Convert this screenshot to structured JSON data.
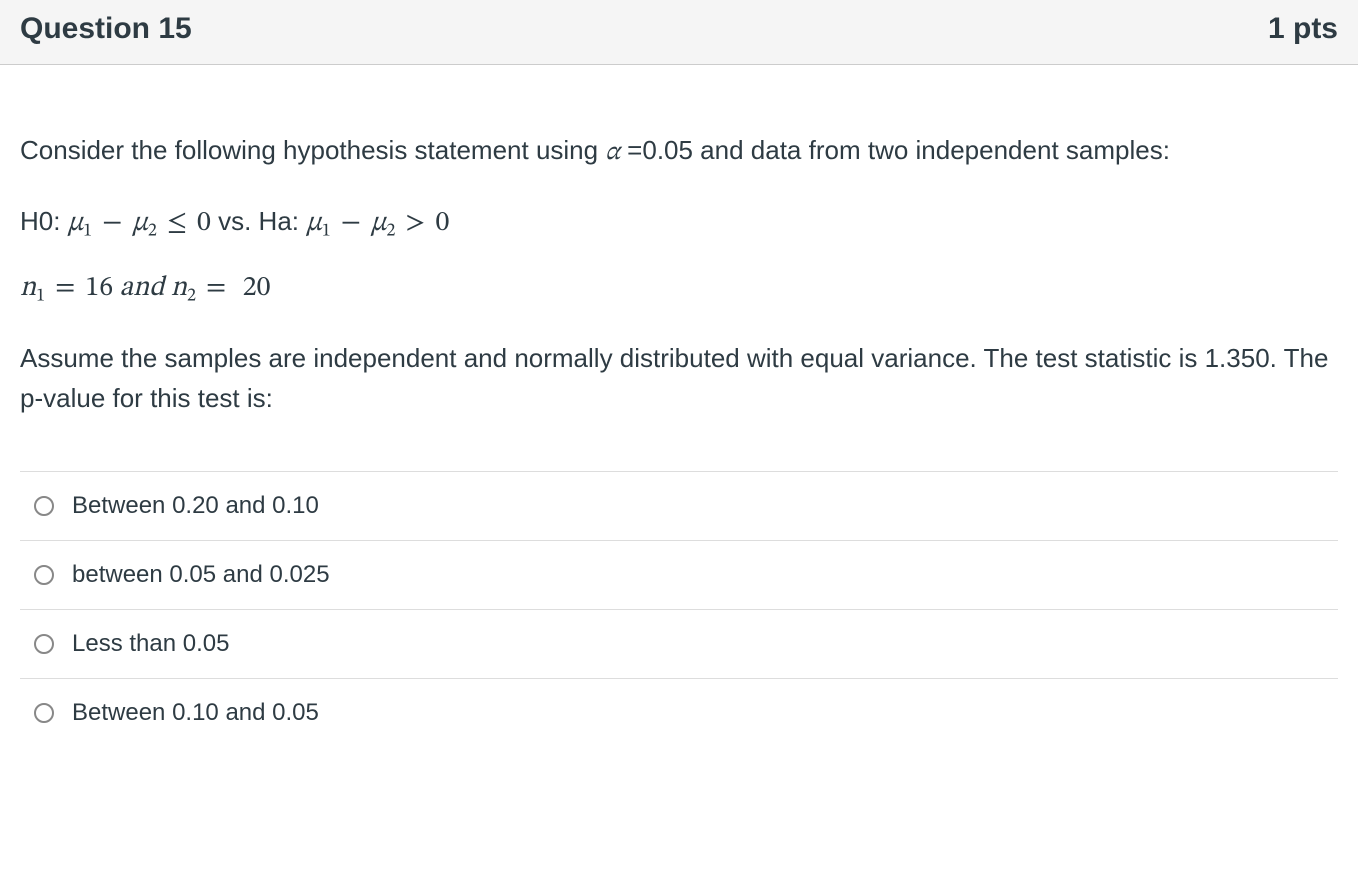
{
  "header": {
    "title": "Question 15",
    "points": "1 pts"
  },
  "prompt": {
    "intro_pre": "Consider the following hypothesis statement using ",
    "alpha_sym": "α",
    "alpha_eq": " =",
    "alpha_val": "0.05 and data from two independent samples:"
  },
  "hypothesis": {
    "h0_label": "H0:  ",
    "mu": "μ",
    "one": "1",
    "two": "2",
    "minus": "−",
    "le": "≤",
    "zero": "0",
    "vs_label": " vs. Ha: ",
    "gt": ">",
    "n": "n",
    "eq": "=",
    "n1_val": "16",
    "and": " and ",
    "n2_val": " 20"
  },
  "prompt2": "Assume the samples are independent and normally distributed with equal variance. The test statistic is 1.350. The p-value for this test is:",
  "options": [
    "Between 0.20 and 0.10",
    "between 0.05 and 0.025",
    "Less than 0.05",
    "Between 0.10 and 0.05"
  ]
}
